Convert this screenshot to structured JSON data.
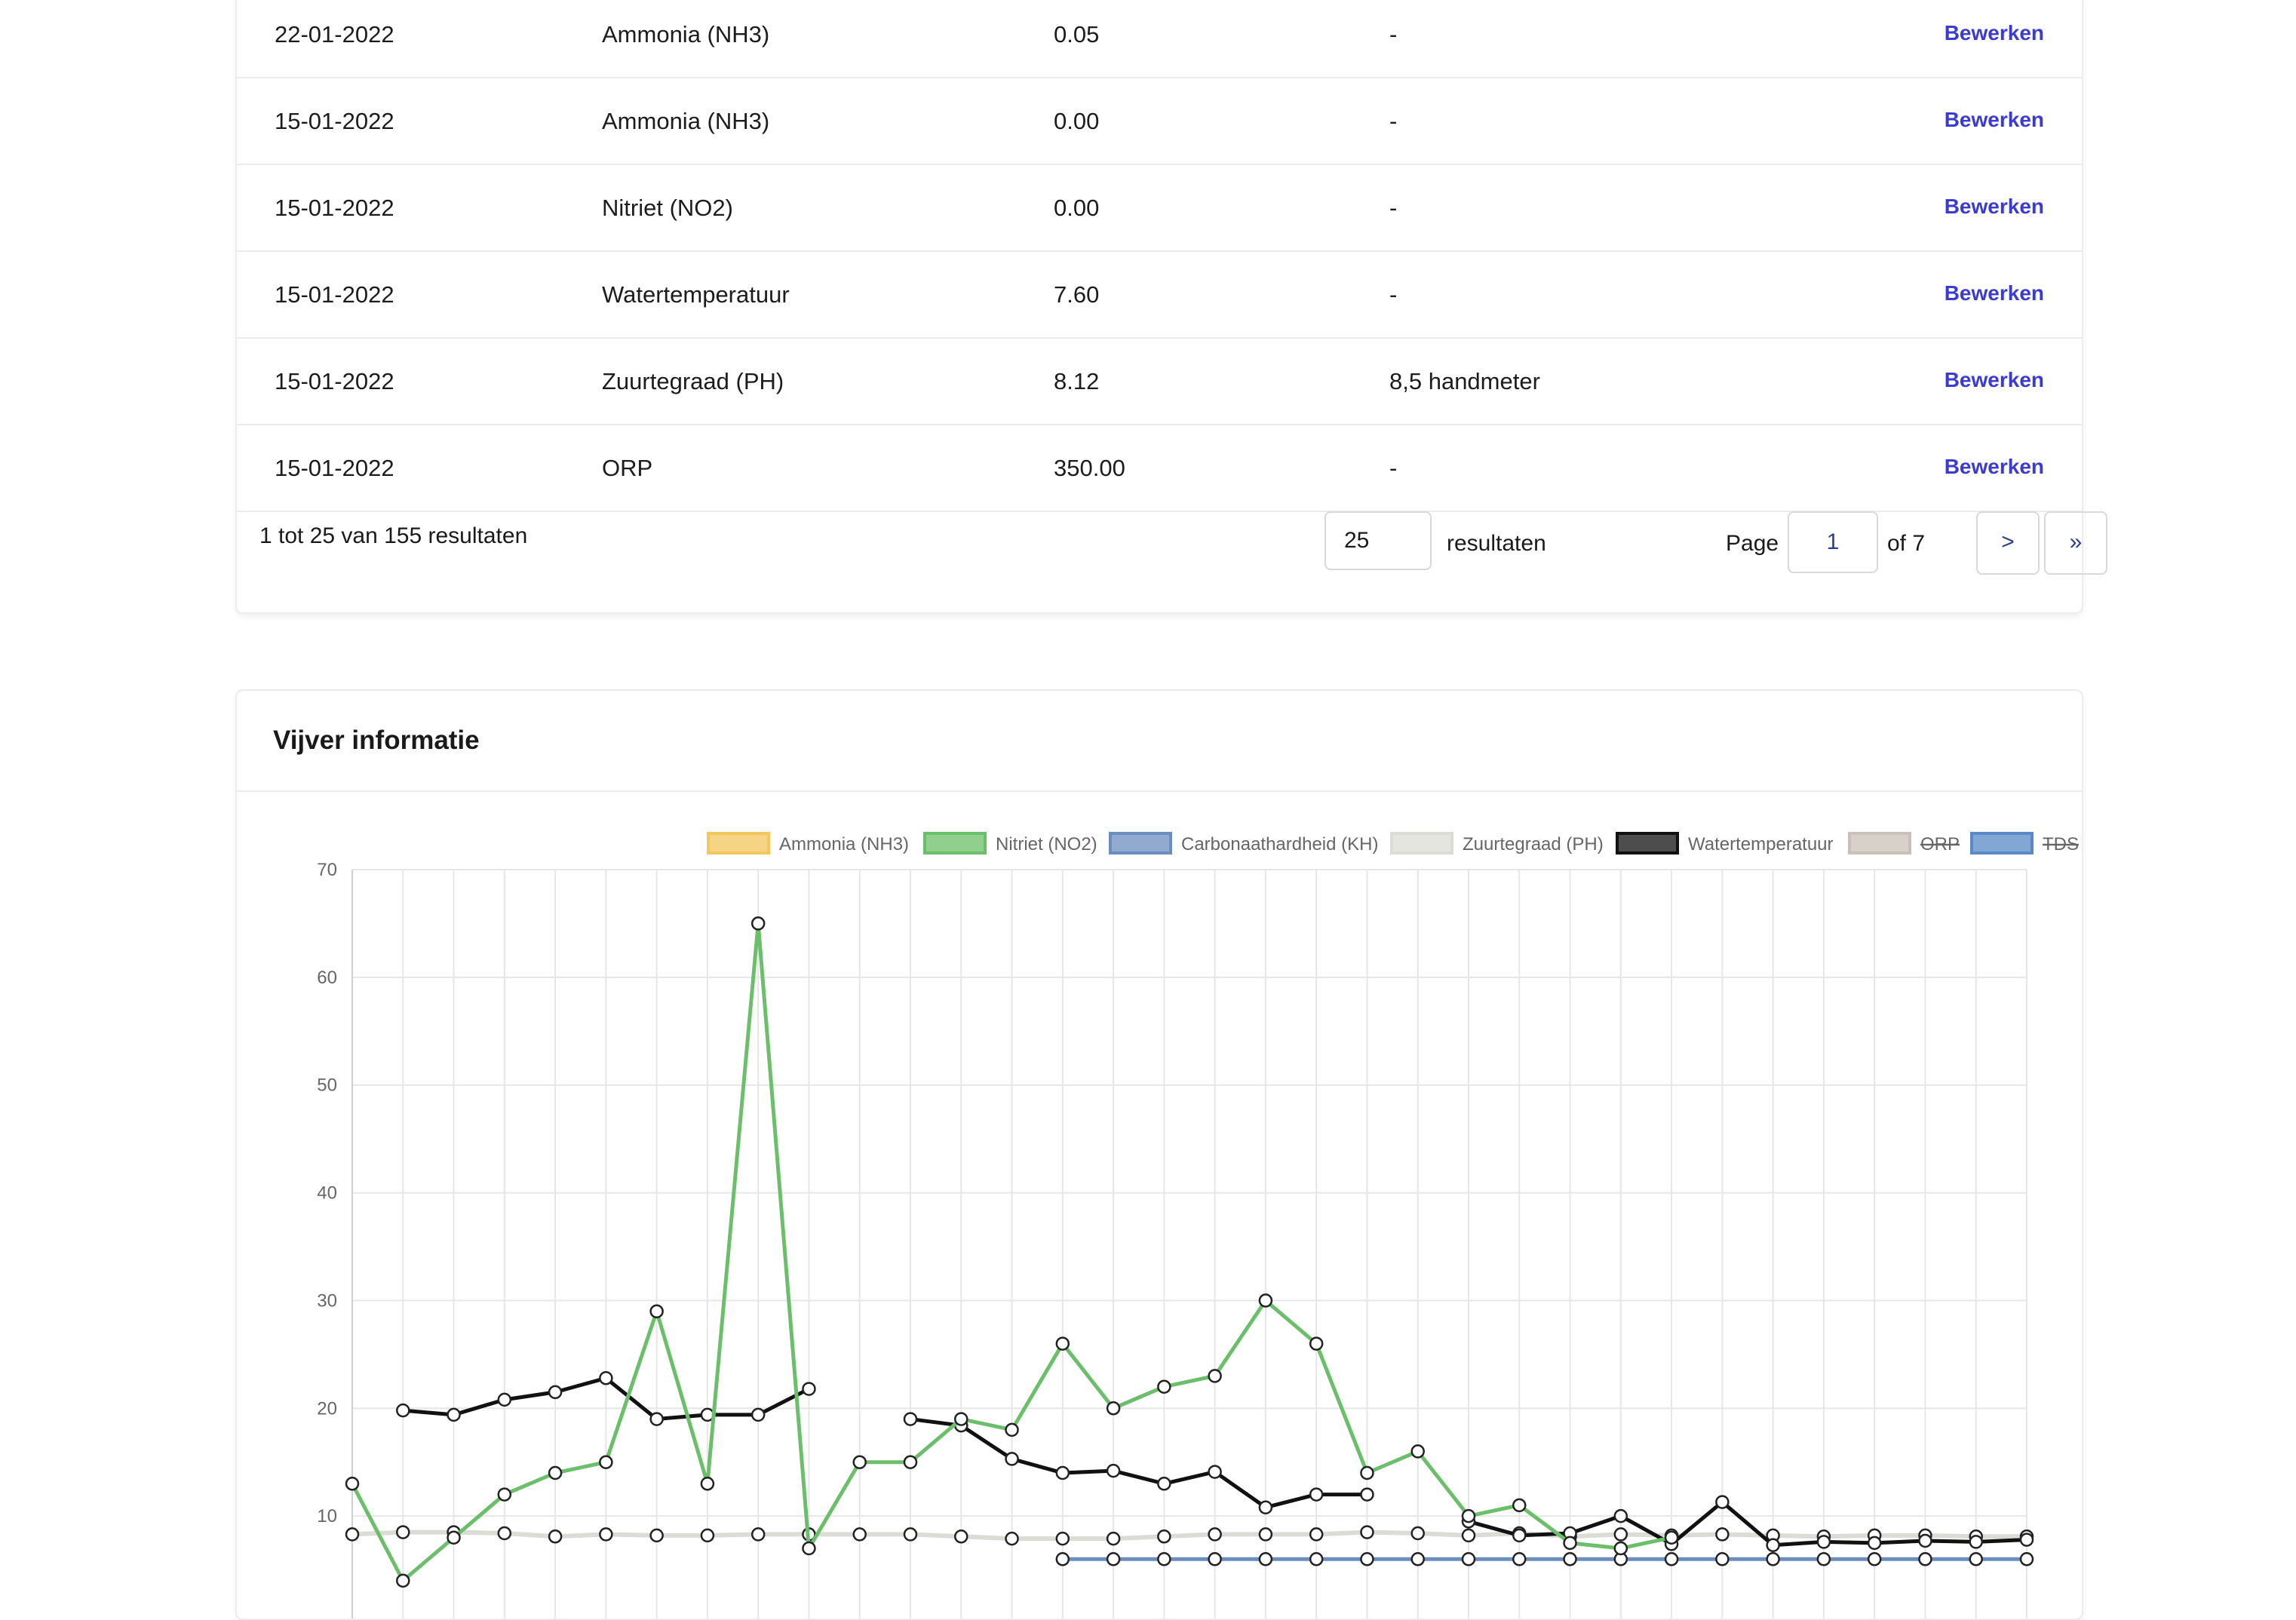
{
  "table": {
    "rows": [
      {
        "date": "22-01-2022",
        "parameter": "Ammonia (NH3)",
        "value": "0.05",
        "note": "-",
        "action": "Bewerken"
      },
      {
        "date": "15-01-2022",
        "parameter": "Ammonia (NH3)",
        "value": "0.00",
        "note": "-",
        "action": "Bewerken"
      },
      {
        "date": "15-01-2022",
        "parameter": "Nitriet (NO2)",
        "value": "0.00",
        "note": "-",
        "action": "Bewerken"
      },
      {
        "date": "15-01-2022",
        "parameter": "Watertemperatuur",
        "value": "7.60",
        "note": "-",
        "action": "Bewerken"
      },
      {
        "date": "15-01-2022",
        "parameter": "Zuurtegraad (PH)",
        "value": "8.12",
        "note": "8,5 handmeter",
        "action": "Bewerken"
      },
      {
        "date": "15-01-2022",
        "parameter": "ORP",
        "value": "350.00",
        "note": "-",
        "action": "Bewerken"
      }
    ],
    "summary": "1 tot 25 van 155 resultaten",
    "per_page_value": "25",
    "per_page_label": "resultaten",
    "page_label": "Page",
    "page_value": "1",
    "of_label": "of 7",
    "next_label": ">",
    "last_label": "»"
  },
  "chart_card": {
    "title": "Vijver informatie"
  },
  "chart_data": {
    "type": "line",
    "ylim": [
      0,
      70
    ],
    "yticks": [
      10,
      20,
      30,
      40,
      50,
      60,
      70
    ],
    "grid": true,
    "legend_position": "top",
    "point_count": 34,
    "series": [
      {
        "name": "Ammonia (NH3)",
        "color": "#f2c75c",
        "hidden": false,
        "values": []
      },
      {
        "name": "Nitriet (NO2)",
        "color": "#6cbf6a",
        "hidden": false,
        "values": [
          13,
          4,
          8,
          12,
          14,
          15,
          29,
          13,
          65,
          7,
          15,
          15,
          19,
          18,
          26,
          20,
          22,
          23,
          30,
          26,
          14,
          16,
          10,
          11,
          7.5,
          7,
          8
        ]
      },
      {
        "name": "Carbonaathardheid (KH)",
        "color": "#6c8ebf",
        "hidden": false,
        "start_index": 14,
        "values": [
          6,
          6,
          6,
          6,
          6,
          6,
          6,
          6,
          6,
          6,
          6,
          6,
          6,
          6,
          6,
          6,
          6,
          6,
          6,
          6
        ]
      },
      {
        "name": "Zuurtegraad (PH)",
        "color": "#dcdcd6",
        "hidden": false,
        "values": [
          8.3,
          8.5,
          8.5,
          8.4,
          8.1,
          8.3,
          8.2,
          8.2,
          8.3,
          8.3,
          8.3,
          8.3,
          8.1,
          7.9,
          7.9,
          7.9,
          8.1,
          8.3,
          8.3,
          8.3,
          8.5,
          8.4,
          8.2,
          8.4,
          8.1,
          8.3,
          8.2,
          8.3,
          8.2,
          8.1,
          8.2,
          8.2,
          8.1,
          8.1
        ]
      },
      {
        "name": "Watertemperatuur",
        "color": "#111111",
        "hidden": false,
        "start_index": 1,
        "values": [
          19.8,
          19.4,
          20.8,
          21.5,
          22.8,
          19,
          19.4,
          19.4,
          21.8,
          null,
          19,
          18.4,
          15.3,
          14,
          14.2,
          13,
          14.1,
          10.8,
          12,
          12,
          null,
          9.5,
          8.2,
          8.4,
          10,
          7.4,
          11.3,
          7.3,
          7.6,
          7.5,
          7.7,
          7.6,
          7.8
        ]
      },
      {
        "name": "ORP",
        "color": "#c9c1b7",
        "hidden": true,
        "values": []
      },
      {
        "name": "TDS",
        "color": "#5a8ac6",
        "hidden": true,
        "values": []
      }
    ]
  }
}
